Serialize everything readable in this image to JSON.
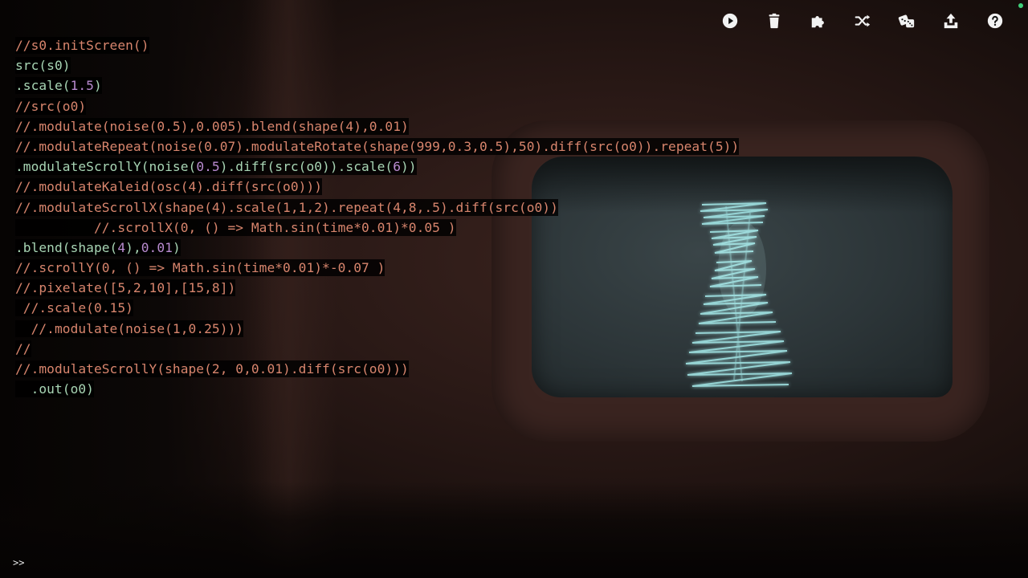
{
  "toolbar": {
    "icons": [
      "play-icon",
      "trash-icon",
      "puzzle-icon",
      "shuffle-icon",
      "dice-icon",
      "upload-icon",
      "help-icon"
    ],
    "status_color": "#3fd07a"
  },
  "code_lines": [
    [
      {
        "t": "//s0.initScreen()",
        "c": "cm"
      }
    ],
    [
      {
        "t": "src(s0)",
        "c": "pl"
      }
    ],
    [
      {
        "t": ".scale(",
        "c": "pl"
      },
      {
        "t": "1.5",
        "c": "num"
      },
      {
        "t": ")",
        "c": "pl"
      }
    ],
    [
      {
        "t": "//src(o0)",
        "c": "cm"
      }
    ],
    [
      {
        "t": "//.modulate(noise(0.5),0.005).blend(shape(4),0.01)",
        "c": "cm"
      }
    ],
    [
      {
        "t": "//.modulateRepeat(noise(0.07).modulateRotate(shape(999,0.3,0.5),50).diff(src(o0)).repeat(5))",
        "c": "cm"
      }
    ],
    [
      {
        "t": ".modulateScrollY(noise(",
        "c": "pl"
      },
      {
        "t": "0.5",
        "c": "num"
      },
      {
        "t": ").diff(src(o0)).scale(",
        "c": "pl"
      },
      {
        "t": "6",
        "c": "num"
      },
      {
        "t": "))",
        "c": "pl"
      }
    ],
    [
      {
        "t": "//.modulateKaleid(osc(4).diff(src(o0)))",
        "c": "cm"
      }
    ],
    [
      {
        "t": "//.modulateScrollX(shape(4).scale(1,1,2).repeat(4,8,.5).diff(src(o0))",
        "c": "cm"
      }
    ],
    [
      {
        "t": "          //.scrollX(0, () => Math.sin(time*0.01)*0.05 )",
        "c": "cm"
      }
    ],
    [
      {
        "t": ".blend(shape(",
        "c": "pl"
      },
      {
        "t": "4",
        "c": "num"
      },
      {
        "t": "),",
        "c": "pl"
      },
      {
        "t": "0.01",
        "c": "num"
      },
      {
        "t": ")",
        "c": "pl"
      }
    ],
    [
      {
        "t": "//.scrollY(0, () => Math.sin(time*0.01)*-0.07 )",
        "c": "cm"
      }
    ],
    [
      {
        "t": "//.pixelate([5,2,10],[15,8])",
        "c": "cm"
      }
    ],
    [
      {
        "t": " //.scale(0.15)",
        "c": "cm"
      }
    ],
    [
      {
        "t": "  //.modulate(noise(1,0.25)))",
        "c": "cm"
      }
    ],
    [
      {
        "t": "//",
        "c": "cm"
      }
    ],
    [
      {
        "t": "//.modulateScrollY(shape(2, 0,0.01).diff(src(o0)))",
        "c": "cm"
      }
    ],
    [
      {
        "t": "  .out(o0)",
        "c": "pl"
      }
    ]
  ],
  "console": {
    "prompt": ">>"
  }
}
